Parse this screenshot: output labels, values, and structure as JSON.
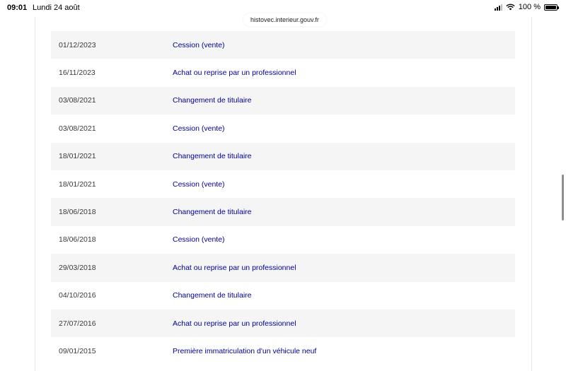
{
  "status_bar": {
    "time": "09:01",
    "date": "Lundi 24 août",
    "battery": "100 %"
  },
  "browser": {
    "url": "histovec.interieur.gouv.fr"
  },
  "colors": {
    "link": "#000091",
    "row_alt": "#f5f5f5"
  },
  "history": {
    "rows": [
      {
        "date": "01/12/2023",
        "operation": "Cession (vente)"
      },
      {
        "date": "16/11/2023",
        "operation": "Achat ou reprise par un professionnel"
      },
      {
        "date": "03/08/2021",
        "operation": "Changement de titulaire"
      },
      {
        "date": "03/08/2021",
        "operation": "Cession (vente)"
      },
      {
        "date": "18/01/2021",
        "operation": "Changement de titulaire"
      },
      {
        "date": "18/01/2021",
        "operation": "Cession (vente)"
      },
      {
        "date": "18/06/2018",
        "operation": "Changement de titulaire"
      },
      {
        "date": "18/06/2018",
        "operation": "Cession (vente)"
      },
      {
        "date": "29/03/2018",
        "operation": "Achat ou reprise par un professionnel"
      },
      {
        "date": "04/10/2016",
        "operation": "Changement de titulaire"
      },
      {
        "date": "27/07/2016",
        "operation": "Achat ou reprise par un professionnel"
      },
      {
        "date": "09/01/2015",
        "operation": "Première immatriculation d'un véhicule neuf"
      }
    ]
  }
}
